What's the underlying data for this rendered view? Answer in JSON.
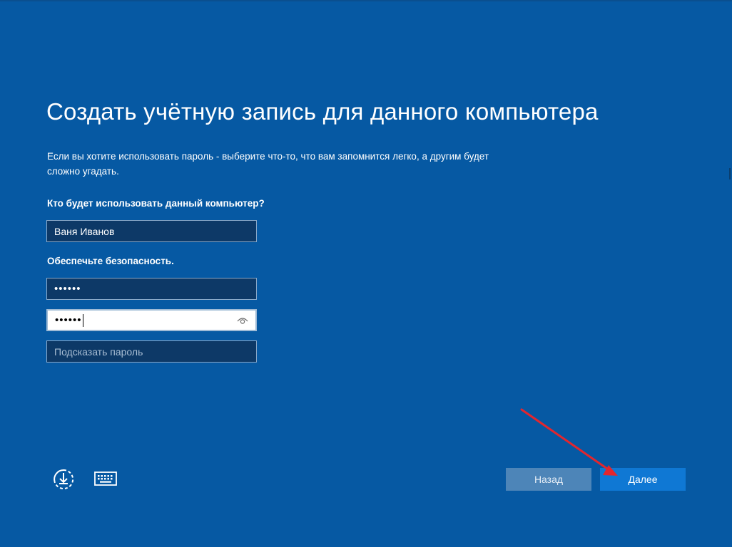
{
  "page": {
    "title": "Создать учётную запись для данного компьютера",
    "description": "Если вы хотите использовать пароль - выберите что-то, что вам запомнится легко, а другим будет сложно угадать.",
    "question_label": "Кто будет использовать данный компьютер?",
    "security_label": "Обеспечьте безопасность."
  },
  "form": {
    "username_value": "Ваня Иванов",
    "password_value": "••••••",
    "password_confirm_value": "••••••",
    "hint_placeholder": "Подсказать пароль"
  },
  "footer": {
    "back_label": "Назад",
    "next_label": "Далее"
  },
  "icons": {
    "ease_of_access": "ease-of-access-icon",
    "keyboard": "keyboard-icon",
    "reveal_password": "eye-icon",
    "annotation": "red-arrow"
  },
  "colors": {
    "background": "#0659a3",
    "field_background": "#0d3967",
    "next_button": "#0f78d4",
    "back_button": "#4d85b8",
    "annotation_arrow": "#e3262e"
  }
}
